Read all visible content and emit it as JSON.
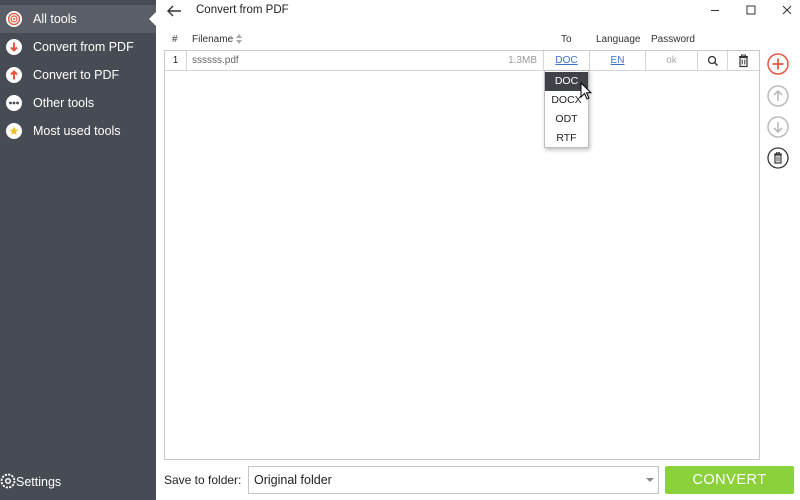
{
  "sidebar": {
    "items": [
      {
        "label": "All tools",
        "icon": "all-tools-icon"
      },
      {
        "label": "Convert from PDF",
        "icon": "arrow-down-circle-icon"
      },
      {
        "label": "Convert to PDF",
        "icon": "arrow-up-circle-icon"
      },
      {
        "label": "Other tools",
        "icon": "ellipsis-circle-icon"
      },
      {
        "label": "Most used tools",
        "icon": "star-circle-icon"
      }
    ],
    "settings_label": "Settings",
    "active_index": 0
  },
  "window": {
    "title": "Convert from PDF"
  },
  "table": {
    "headers": {
      "index": "#",
      "filename": "Filename",
      "to": "To",
      "language": "Language",
      "password": "Password"
    },
    "rows": [
      {
        "index": "1",
        "filename": "ssssss.pdf",
        "size": "1.3MB",
        "to": "DOC",
        "language": "EN",
        "password": "ok"
      }
    ]
  },
  "dropdown": {
    "options": [
      "DOC",
      "DOCX",
      "ODT",
      "RTF"
    ],
    "selected": "DOC"
  },
  "bottom": {
    "save_label": "Save to folder:",
    "folder_value": "Original folder",
    "convert_label": "CONVERT"
  },
  "colors": {
    "sidebar_bg": "#474b53",
    "accent_red": "#e8563f",
    "convert_green": "#8bd13c",
    "link_blue": "#3b73c4"
  }
}
